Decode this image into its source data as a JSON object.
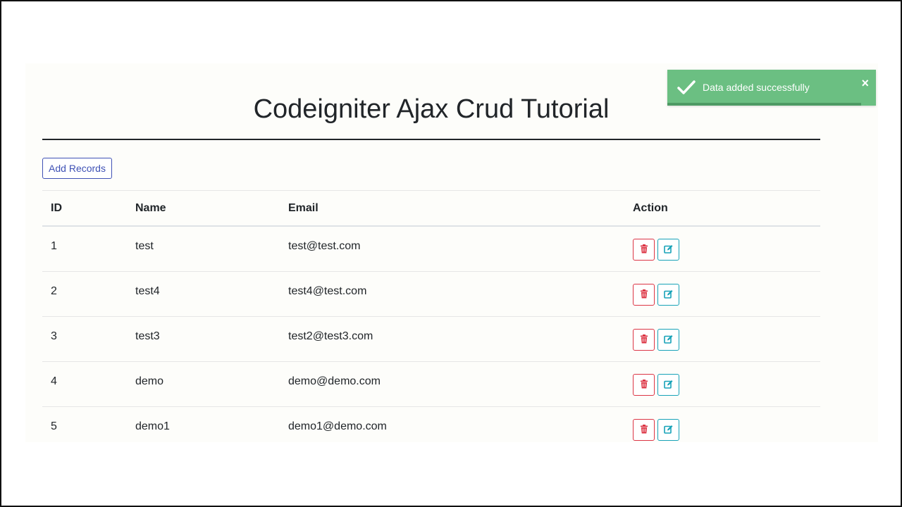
{
  "page": {
    "title": "Codeigniter Ajax Crud Tutorial",
    "add_button_label": "Add Records"
  },
  "table": {
    "headers": {
      "id": "ID",
      "name": "Name",
      "email": "Email",
      "action": "Action"
    },
    "rows": [
      {
        "id": "1",
        "name": "test",
        "email": "test@test.com"
      },
      {
        "id": "2",
        "name": "test4",
        "email": "test4@test.com"
      },
      {
        "id": "3",
        "name": "test3",
        "email": "test2@test3.com"
      },
      {
        "id": "4",
        "name": "demo",
        "email": "demo@demo.com"
      },
      {
        "id": "5",
        "name": "demo1",
        "email": "demo1@demo.com"
      }
    ],
    "row_actions": {
      "delete_icon": "trash-icon",
      "edit_icon": "edit-icon"
    }
  },
  "toast": {
    "message": "Data added successfully",
    "close_symbol": "×",
    "icon": "check-icon",
    "progress": 0.93
  },
  "colors": {
    "primary": "#3f51b5",
    "danger": "#dc3545",
    "info": "#17a2b8",
    "success_toast": "#6bbf82"
  }
}
